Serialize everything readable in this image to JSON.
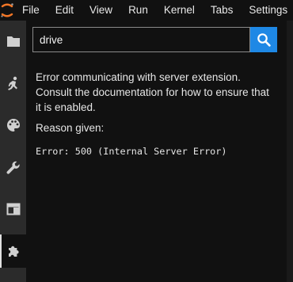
{
  "menubar": {
    "items": [
      "File",
      "Edit",
      "View",
      "Run",
      "Kernel",
      "Tabs",
      "Settings"
    ]
  },
  "sidebar": {
    "icons": [
      "folder-icon",
      "running-icon",
      "palette-icon",
      "wrench-icon",
      "tabs-icon",
      "extension-icon"
    ],
    "active": "extension-icon"
  },
  "search": {
    "value": "drive",
    "placeholder": ""
  },
  "message": {
    "error_text": "Error communicating with server extension. Consult the documentation for how to ensure that it is enabled.",
    "reason_label": "Reason given:",
    "error_detail": "Error: 500 (Internal Server Error)"
  },
  "colors": {
    "background": "#111111",
    "sidebar": "#2b2b2b",
    "accent": "#1e88e5",
    "logo": "#f37626",
    "text": "#e6e6e6"
  }
}
